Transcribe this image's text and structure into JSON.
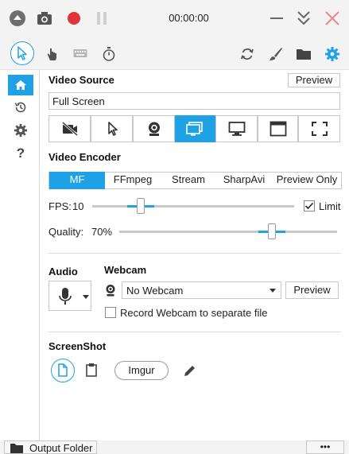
{
  "titlebar": {
    "timer": "00:00:00",
    "icons": [
      "collapse-icon",
      "camera-icon",
      "record-icon",
      "pause-icon",
      "minimize-icon",
      "expand-icon",
      "close-icon"
    ]
  },
  "toolbar": {
    "icons": [
      "cursor-icon",
      "hand-icon",
      "keyboard-icon",
      "stopwatch-icon",
      "refresh-icon",
      "brush-icon",
      "folder-icon",
      "gear-icon"
    ]
  },
  "sidebar": {
    "items": [
      "home-icon",
      "history-icon",
      "settings-icon",
      "help-icon"
    ],
    "help_glyph": "?"
  },
  "video_source": {
    "title": "Video Source",
    "preview_label": "Preview",
    "value": "Full Screen",
    "sources": [
      "no-video",
      "region",
      "webcam",
      "screen",
      "window-region",
      "window",
      "fullscreen"
    ],
    "active_index": 3
  },
  "video_encoder": {
    "title": "Video Encoder",
    "tabs": [
      "MF",
      "FFmpeg",
      "Stream",
      "SharpAvi",
      "Preview Only"
    ],
    "active_index": 0,
    "fps_label": "FPS:",
    "fps_value": "10",
    "fps_level": 0.24,
    "limit_label": "Limit",
    "limit_checked": true,
    "quality_label": "Quality:",
    "quality_value": "70%",
    "quality_level": 0.7
  },
  "audio": {
    "title": "Audio"
  },
  "webcam": {
    "title": "Webcam",
    "selected": "No Webcam",
    "preview_label": "Preview",
    "separate_file_label": "Record Webcam to separate file",
    "separate_file_checked": false
  },
  "screenshot": {
    "title": "ScreenShot",
    "imgur_label": "Imgur"
  },
  "footer": {
    "output_folder_label": "Output Folder",
    "more_label": "•••"
  },
  "colors": {
    "accent": "#1fa1e6",
    "record": "#e0333a",
    "close": "#e88a8a"
  }
}
